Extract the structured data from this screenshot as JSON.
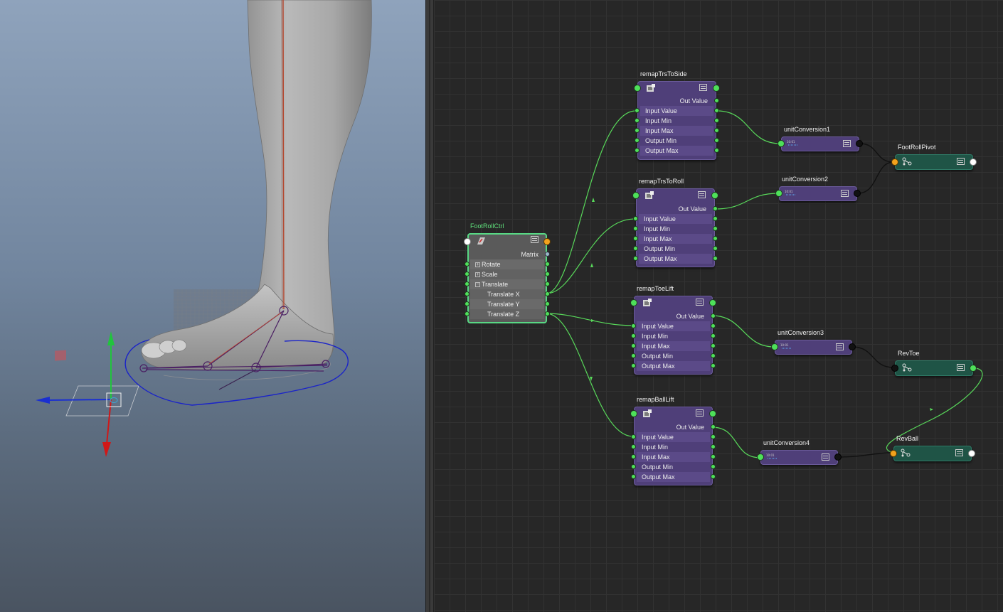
{
  "node_editor": {
    "nodes": {
      "foot_roll_ctrl": {
        "name": "FootRollCtrl",
        "matrix_label": "Matrix",
        "attrs": [
          "Rotate",
          "Scale",
          "Translate",
          "Translate X",
          "Translate Y",
          "Translate Z"
        ]
      },
      "remap_trs_to_side": {
        "name": "remapTrsToSide",
        "out_label": "Out Value",
        "inputs": [
          "Input Value",
          "Input Min",
          "Input Max",
          "Output Min",
          "Output Max"
        ]
      },
      "remap_trs_to_roll": {
        "name": "remapTrsToRoll",
        "out_label": "Out Value",
        "inputs": [
          "Input Value",
          "Input Min",
          "Input Max",
          "Output Min",
          "Output Max"
        ]
      },
      "remap_toe_lift": {
        "name": "remapToeLift",
        "out_label": "Out Value",
        "inputs": [
          "Input Value",
          "Input Min",
          "Input Max",
          "Output Min",
          "Output Max"
        ]
      },
      "remap_ball_lift": {
        "name": "remapBallLift",
        "out_label": "Out Value",
        "inputs": [
          "Input Value",
          "Input Min",
          "Input Max",
          "Output Min",
          "Output Max"
        ]
      },
      "unit_conversion_1": {
        "name": "unitConversion1"
      },
      "unit_conversion_2": {
        "name": "unitConversion2"
      },
      "unit_conversion_3": {
        "name": "unitConversion3"
      },
      "unit_conversion_4": {
        "name": "unitConversion4"
      },
      "foot_roll_pivot": {
        "name": "FootRollPivot"
      },
      "rev_toe": {
        "name": "RevToe"
      },
      "rev_ball": {
        "name": "RevBall"
      }
    }
  },
  "colors": {
    "viewport_top": "#8fa3bc",
    "viewport_bottom": "#4a5461",
    "remap_node": "#4f3f79",
    "joint_node": "#1f5446",
    "transform_border": "#58d884",
    "connection": "#58d85a",
    "port_green": "#4ee05a",
    "port_orange": "#f2a21d"
  },
  "icons": [
    "move-manipulator-icon",
    "remap-node-icon",
    "transform-node-icon",
    "joint-node-icon",
    "unit-conversion-icon",
    "attribute-list-icon"
  ]
}
